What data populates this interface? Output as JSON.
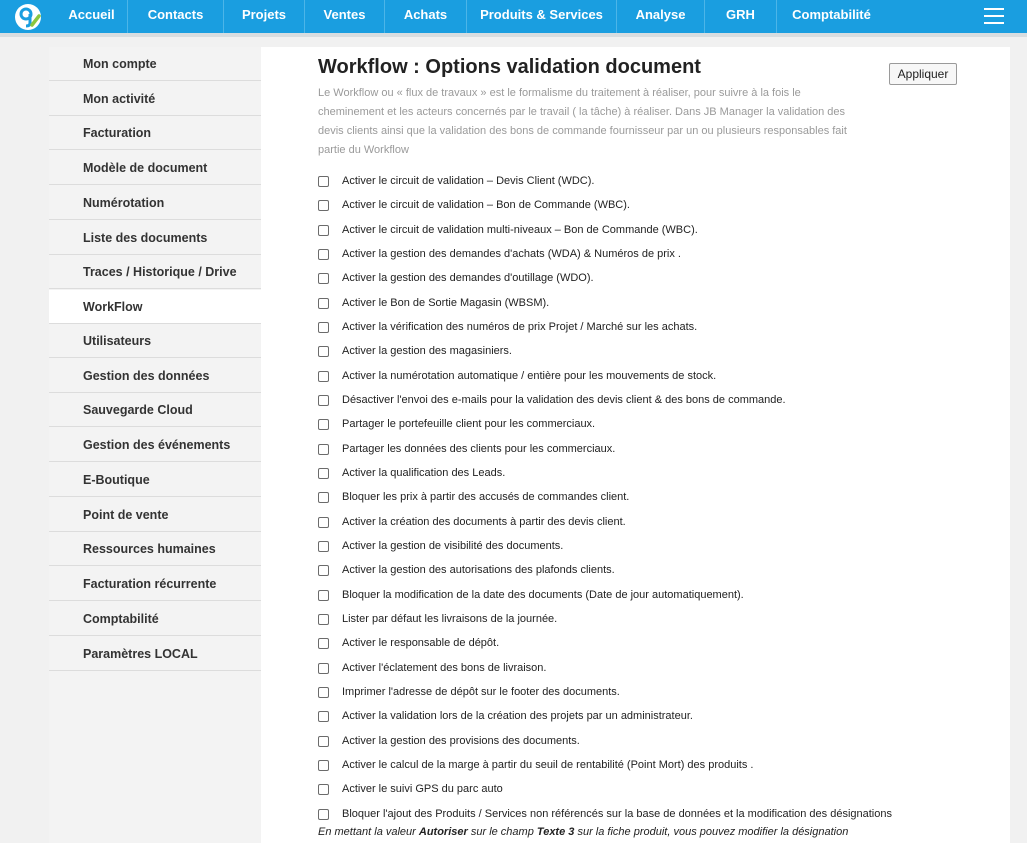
{
  "nav": {
    "items": [
      {
        "label": "Accueil"
      },
      {
        "label": "Contacts"
      },
      {
        "label": "Projets"
      },
      {
        "label": "Ventes"
      },
      {
        "label": "Achats"
      },
      {
        "label": "Produits & Services"
      },
      {
        "label": "Analyse"
      },
      {
        "label": "GRH"
      },
      {
        "label": "Comptabilité"
      }
    ],
    "colors": {
      "bar": "#1a9ee0",
      "logo_green": "#8cc63f"
    }
  },
  "sidebar": {
    "items": [
      {
        "label": "Mon compte"
      },
      {
        "label": "Mon activité"
      },
      {
        "label": "Facturation"
      },
      {
        "label": "Modèle de document"
      },
      {
        "label": "Numérotation"
      },
      {
        "label": "Liste des documents"
      },
      {
        "label": "Traces / Historique / Drive"
      },
      {
        "label": "WorkFlow",
        "active": true
      },
      {
        "label": "Utilisateurs"
      },
      {
        "label": "Gestion des données"
      },
      {
        "label": "Sauvegarde Cloud"
      },
      {
        "label": "Gestion des événements"
      },
      {
        "label": "E-Boutique"
      },
      {
        "label": "Point de vente"
      },
      {
        "label": "Ressources humaines"
      },
      {
        "label": "Facturation récurrente"
      },
      {
        "label": "Comptabilité"
      },
      {
        "label": "Paramètres LOCAL"
      }
    ]
  },
  "main": {
    "title": "Workflow : Options validation document",
    "apply_label": "Appliquer",
    "intro": [
      "Le Workflow ou « flux de travaux » est le formalisme du traitement à réaliser, pour suivre à la fois le",
      "cheminement et les acteurs concernés par le travail ( la tâche) à réaliser. Dans JB Manager la validation des",
      "devis clients ainsi que la validation des bons de commande fournisseur par un ou plusieurs responsables fait",
      "partie du Workflow"
    ],
    "options": [
      {
        "label": "Activer le circuit de validation – Devis Client (WDC).",
        "checked": false
      },
      {
        "label": "Activer le circuit de validation – Bon de Commande (WBC).",
        "checked": false
      },
      {
        "label": "Activer le circuit de validation multi-niveaux – Bon de Commande (WBC).",
        "checked": false
      },
      {
        "label": "Activer la gestion des demandes d'achats (WDA) & Numéros de prix .",
        "checked": false
      },
      {
        "label": "Activer la gestion des demandes d'outillage (WDO).",
        "checked": false
      },
      {
        "label": "Activer le Bon de Sortie Magasin (WBSM).",
        "checked": false
      },
      {
        "label": "Activer la vérification des numéros de prix Projet / Marché sur les achats.",
        "checked": false
      },
      {
        "label": "Activer la gestion des magasiniers.",
        "checked": false
      },
      {
        "label": "Activer la numérotation automatique / entière pour les mouvements de stock.",
        "checked": false
      },
      {
        "label": "Désactiver l'envoi des e-mails pour la validation des devis client & des bons de commande.",
        "checked": false
      },
      {
        "label": "Partager le portefeuille client pour les commerciaux.",
        "checked": false
      },
      {
        "label": "Partager les données des clients pour les commerciaux.",
        "checked": false
      },
      {
        "label": "Activer la qualification des Leads.",
        "checked": false
      },
      {
        "label": "Bloquer les prix à partir des accusés de commandes client.",
        "checked": false
      },
      {
        "label": "Activer la création des documents à partir des devis client.",
        "checked": false
      },
      {
        "label": "Activer la gestion de visibilité des documents.",
        "checked": false
      },
      {
        "label": "Activer la gestion des autorisations des plafonds clients.",
        "checked": false
      },
      {
        "label": "Bloquer la modification de la date des documents (Date de jour automatiquement).",
        "checked": false
      },
      {
        "label": "Lister par défaut les livraisons de la journée.",
        "checked": false
      },
      {
        "label": "Activer le responsable de dépôt.",
        "checked": false
      },
      {
        "label": "Activer l'éclatement des bons de livraison.",
        "checked": false
      },
      {
        "label": "Imprimer l'adresse de dépôt sur le footer des documents.",
        "checked": false
      },
      {
        "label": "Activer la validation lors de la création des projets par un administrateur.",
        "checked": false
      },
      {
        "label": "Activer la gestion des provisions des documents.",
        "checked": false
      },
      {
        "label": "Activer le calcul de la marge à partir du seuil de rentabilité (Point Mort) des produits .",
        "checked": false
      },
      {
        "label": "Activer le suivi GPS du parc auto",
        "checked": false
      },
      {
        "label": "Bloquer l'ajout des Produits / Services non référencés sur la base de données et la modification des désignations",
        "checked": false
      }
    ],
    "note": {
      "part1": "En mettant la valeur ",
      "bold1": "Autoriser",
      "part2": " sur le champ ",
      "bold2": "Texte 3",
      "part3": " sur la fiche produit, vous pouvez modifier la désignation"
    }
  }
}
